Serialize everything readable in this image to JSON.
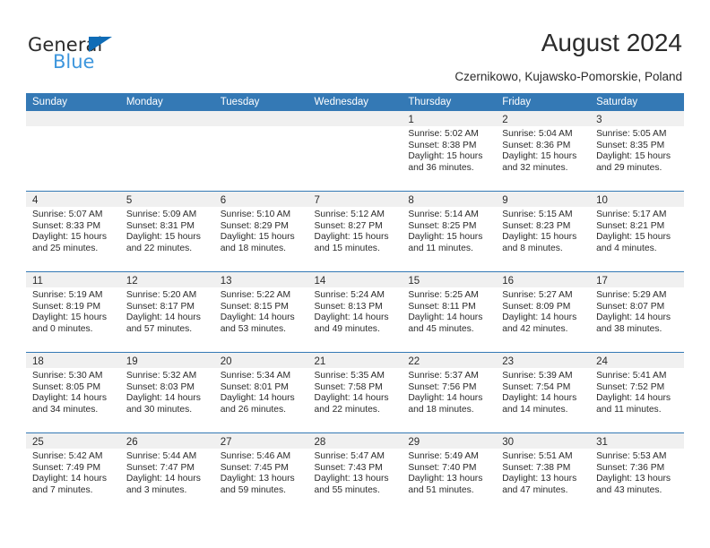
{
  "brand": {
    "name_part1": "General",
    "name_part2": "Blue",
    "triangle_color": "#0f6cb6",
    "blue_color": "#3d96dd"
  },
  "header": {
    "title": "August 2024",
    "subtitle": "Czernikowo, Kujawsko-Pomorskie, Poland",
    "accent_color": "#3479b5",
    "band_color": "#f0f0f0"
  },
  "weekdays": [
    "Sunday",
    "Monday",
    "Tuesday",
    "Wednesday",
    "Thursday",
    "Friday",
    "Saturday"
  ],
  "weeks": [
    [
      {
        "day": "",
        "l1": "",
        "l2": "",
        "l3": "",
        "l4": ""
      },
      {
        "day": "",
        "l1": "",
        "l2": "",
        "l3": "",
        "l4": ""
      },
      {
        "day": "",
        "l1": "",
        "l2": "",
        "l3": "",
        "l4": ""
      },
      {
        "day": "",
        "l1": "",
        "l2": "",
        "l3": "",
        "l4": ""
      },
      {
        "day": "1",
        "l1": "Sunrise: 5:02 AM",
        "l2": "Sunset: 8:38 PM",
        "l3": "Daylight: 15 hours",
        "l4": "and 36 minutes."
      },
      {
        "day": "2",
        "l1": "Sunrise: 5:04 AM",
        "l2": "Sunset: 8:36 PM",
        "l3": "Daylight: 15 hours",
        "l4": "and 32 minutes."
      },
      {
        "day": "3",
        "l1": "Sunrise: 5:05 AM",
        "l2": "Sunset: 8:35 PM",
        "l3": "Daylight: 15 hours",
        "l4": "and 29 minutes."
      }
    ],
    [
      {
        "day": "4",
        "l1": "Sunrise: 5:07 AM",
        "l2": "Sunset: 8:33 PM",
        "l3": "Daylight: 15 hours",
        "l4": "and 25 minutes."
      },
      {
        "day": "5",
        "l1": "Sunrise: 5:09 AM",
        "l2": "Sunset: 8:31 PM",
        "l3": "Daylight: 15 hours",
        "l4": "and 22 minutes."
      },
      {
        "day": "6",
        "l1": "Sunrise: 5:10 AM",
        "l2": "Sunset: 8:29 PM",
        "l3": "Daylight: 15 hours",
        "l4": "and 18 minutes."
      },
      {
        "day": "7",
        "l1": "Sunrise: 5:12 AM",
        "l2": "Sunset: 8:27 PM",
        "l3": "Daylight: 15 hours",
        "l4": "and 15 minutes."
      },
      {
        "day": "8",
        "l1": "Sunrise: 5:14 AM",
        "l2": "Sunset: 8:25 PM",
        "l3": "Daylight: 15 hours",
        "l4": "and 11 minutes."
      },
      {
        "day": "9",
        "l1": "Sunrise: 5:15 AM",
        "l2": "Sunset: 8:23 PM",
        "l3": "Daylight: 15 hours",
        "l4": "and 8 minutes."
      },
      {
        "day": "10",
        "l1": "Sunrise: 5:17 AM",
        "l2": "Sunset: 8:21 PM",
        "l3": "Daylight: 15 hours",
        "l4": "and 4 minutes."
      }
    ],
    [
      {
        "day": "11",
        "l1": "Sunrise: 5:19 AM",
        "l2": "Sunset: 8:19 PM",
        "l3": "Daylight: 15 hours",
        "l4": "and 0 minutes."
      },
      {
        "day": "12",
        "l1": "Sunrise: 5:20 AM",
        "l2": "Sunset: 8:17 PM",
        "l3": "Daylight: 14 hours",
        "l4": "and 57 minutes."
      },
      {
        "day": "13",
        "l1": "Sunrise: 5:22 AM",
        "l2": "Sunset: 8:15 PM",
        "l3": "Daylight: 14 hours",
        "l4": "and 53 minutes."
      },
      {
        "day": "14",
        "l1": "Sunrise: 5:24 AM",
        "l2": "Sunset: 8:13 PM",
        "l3": "Daylight: 14 hours",
        "l4": "and 49 minutes."
      },
      {
        "day": "15",
        "l1": "Sunrise: 5:25 AM",
        "l2": "Sunset: 8:11 PM",
        "l3": "Daylight: 14 hours",
        "l4": "and 45 minutes."
      },
      {
        "day": "16",
        "l1": "Sunrise: 5:27 AM",
        "l2": "Sunset: 8:09 PM",
        "l3": "Daylight: 14 hours",
        "l4": "and 42 minutes."
      },
      {
        "day": "17",
        "l1": "Sunrise: 5:29 AM",
        "l2": "Sunset: 8:07 PM",
        "l3": "Daylight: 14 hours",
        "l4": "and 38 minutes."
      }
    ],
    [
      {
        "day": "18",
        "l1": "Sunrise: 5:30 AM",
        "l2": "Sunset: 8:05 PM",
        "l3": "Daylight: 14 hours",
        "l4": "and 34 minutes."
      },
      {
        "day": "19",
        "l1": "Sunrise: 5:32 AM",
        "l2": "Sunset: 8:03 PM",
        "l3": "Daylight: 14 hours",
        "l4": "and 30 minutes."
      },
      {
        "day": "20",
        "l1": "Sunrise: 5:34 AM",
        "l2": "Sunset: 8:01 PM",
        "l3": "Daylight: 14 hours",
        "l4": "and 26 minutes."
      },
      {
        "day": "21",
        "l1": "Sunrise: 5:35 AM",
        "l2": "Sunset: 7:58 PM",
        "l3": "Daylight: 14 hours",
        "l4": "and 22 minutes."
      },
      {
        "day": "22",
        "l1": "Sunrise: 5:37 AM",
        "l2": "Sunset: 7:56 PM",
        "l3": "Daylight: 14 hours",
        "l4": "and 18 minutes."
      },
      {
        "day": "23",
        "l1": "Sunrise: 5:39 AM",
        "l2": "Sunset: 7:54 PM",
        "l3": "Daylight: 14 hours",
        "l4": "and 14 minutes."
      },
      {
        "day": "24",
        "l1": "Sunrise: 5:41 AM",
        "l2": "Sunset: 7:52 PM",
        "l3": "Daylight: 14 hours",
        "l4": "and 11 minutes."
      }
    ],
    [
      {
        "day": "25",
        "l1": "Sunrise: 5:42 AM",
        "l2": "Sunset: 7:49 PM",
        "l3": "Daylight: 14 hours",
        "l4": "and 7 minutes."
      },
      {
        "day": "26",
        "l1": "Sunrise: 5:44 AM",
        "l2": "Sunset: 7:47 PM",
        "l3": "Daylight: 14 hours",
        "l4": "and 3 minutes."
      },
      {
        "day": "27",
        "l1": "Sunrise: 5:46 AM",
        "l2": "Sunset: 7:45 PM",
        "l3": "Daylight: 13 hours",
        "l4": "and 59 minutes."
      },
      {
        "day": "28",
        "l1": "Sunrise: 5:47 AM",
        "l2": "Sunset: 7:43 PM",
        "l3": "Daylight: 13 hours",
        "l4": "and 55 minutes."
      },
      {
        "day": "29",
        "l1": "Sunrise: 5:49 AM",
        "l2": "Sunset: 7:40 PM",
        "l3": "Daylight: 13 hours",
        "l4": "and 51 minutes."
      },
      {
        "day": "30",
        "l1": "Sunrise: 5:51 AM",
        "l2": "Sunset: 7:38 PM",
        "l3": "Daylight: 13 hours",
        "l4": "and 47 minutes."
      },
      {
        "day": "31",
        "l1": "Sunrise: 5:53 AM",
        "l2": "Sunset: 7:36 PM",
        "l3": "Daylight: 13 hours",
        "l4": "and 43 minutes."
      }
    ]
  ]
}
